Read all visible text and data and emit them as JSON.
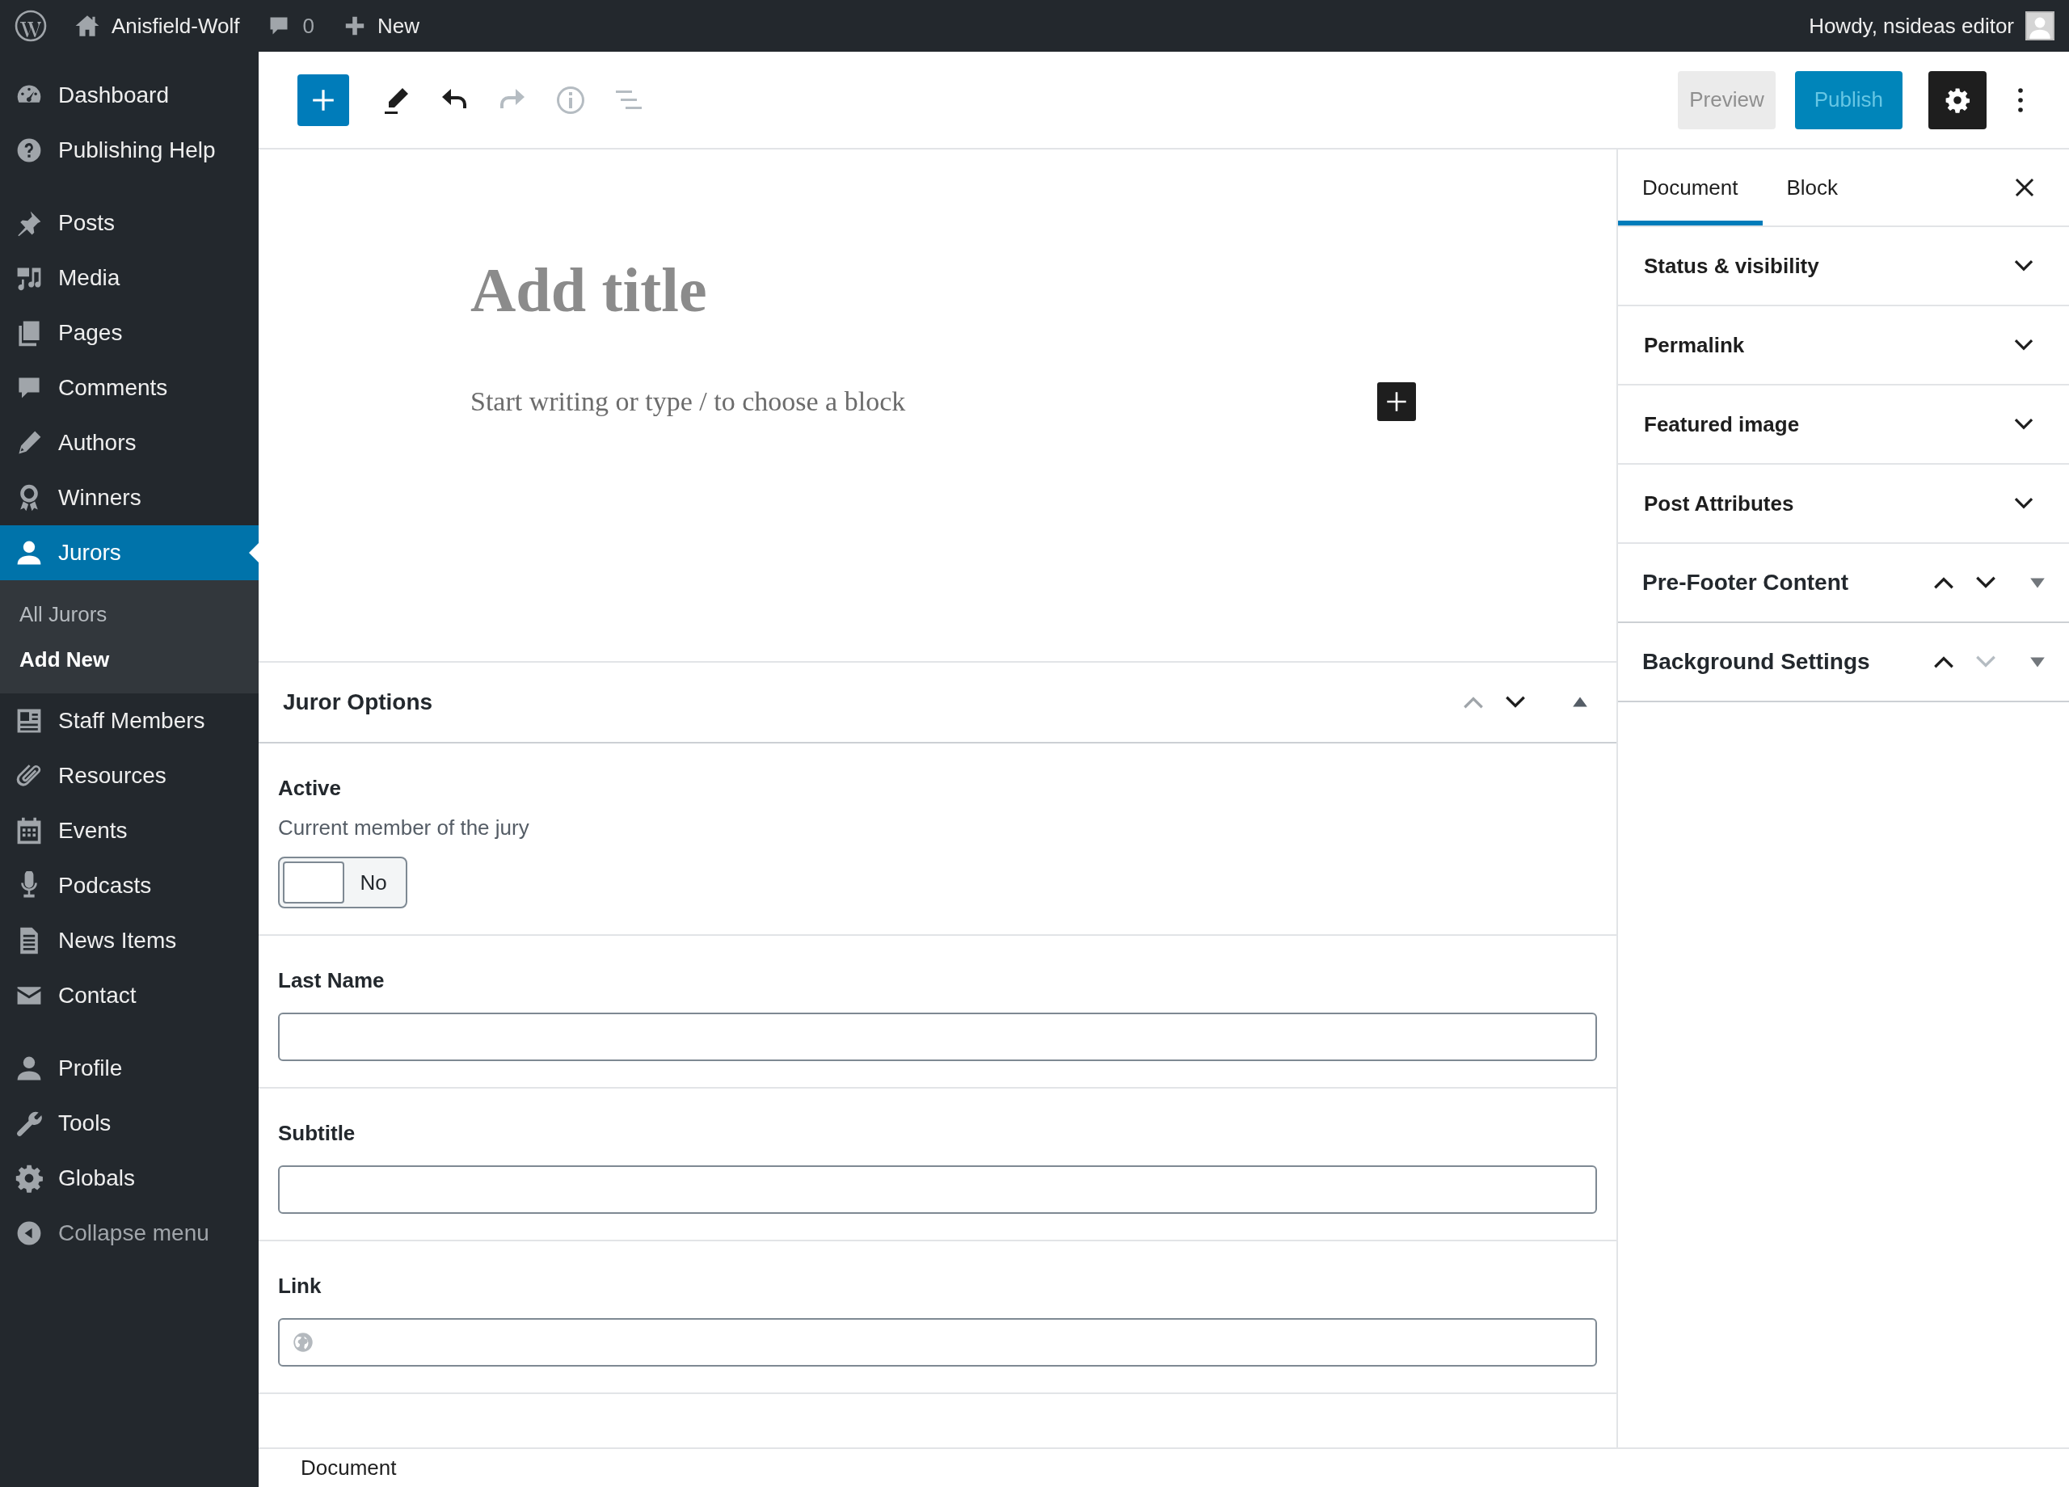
{
  "admin_bar": {
    "site_name": "Anisfield-Wolf",
    "comment_count": "0",
    "new_label": "New",
    "greeting": "Howdy, nsideas editor"
  },
  "admin_menu": {
    "groups": [
      [
        {
          "label": "Dashboard",
          "kind": "item",
          "selected": false
        },
        {
          "label": "Publishing Help",
          "kind": "item",
          "selected": false
        }
      ],
      [
        {
          "label": "Posts",
          "kind": "item",
          "selected": false
        },
        {
          "label": "Media",
          "kind": "item",
          "selected": false
        },
        {
          "label": "Pages",
          "kind": "item",
          "selected": false
        },
        {
          "label": "Comments",
          "kind": "item",
          "selected": false
        },
        {
          "label": "Authors",
          "kind": "item",
          "selected": false
        },
        {
          "label": "Winners",
          "kind": "item",
          "selected": false
        },
        {
          "label": "Jurors",
          "kind": "item",
          "selected": true,
          "children": [
            {
              "label": "All Jurors",
              "selected": false
            },
            {
              "label": "Add New",
              "selected": true
            }
          ]
        },
        {
          "label": "Staff Members",
          "kind": "item",
          "selected": false
        },
        {
          "label": "Resources",
          "kind": "item",
          "selected": false
        },
        {
          "label": "Events",
          "kind": "item",
          "selected": false
        },
        {
          "label": "Podcasts",
          "kind": "item",
          "selected": false
        },
        {
          "label": "News Items",
          "kind": "item",
          "selected": false
        },
        {
          "label": "Contact",
          "kind": "item",
          "selected": false
        }
      ],
      [
        {
          "label": "Profile",
          "kind": "item",
          "selected": false
        },
        {
          "label": "Tools",
          "kind": "item",
          "selected": false
        },
        {
          "label": "Globals",
          "kind": "item",
          "selected": false
        },
        {
          "label": "Collapse menu",
          "kind": "collapse",
          "selected": false
        }
      ]
    ]
  },
  "toolbar": {
    "tools": [
      {
        "disabled": false
      },
      {
        "disabled": false
      },
      {
        "disabled": true
      },
      {
        "disabled": true
      },
      {
        "disabled": true
      }
    ],
    "preview": {
      "label": "Preview",
      "disabled": true
    },
    "publish": {
      "label": "Publish",
      "disabled": true
    },
    "settings_pressed": true
  },
  "editor": {
    "title_placeholder": "Add title",
    "block_placeholder": "Start writing or type / to choose a block"
  },
  "meta_box": {
    "title": "Juror Options",
    "expanded": true,
    "move_up_disabled": true,
    "move_down_disabled": false,
    "fields": [
      {
        "kind": "toggle",
        "label": "Active",
        "description": "Current member of the jury",
        "on": false,
        "state_label": "No"
      },
      {
        "kind": "text",
        "label": "Last Name"
      },
      {
        "kind": "text",
        "label": "Subtitle"
      },
      {
        "kind": "url",
        "label": "Link"
      }
    ]
  },
  "settings_sidebar": {
    "tabs": [
      {
        "label": "Document",
        "selected": true
      },
      {
        "label": "Block",
        "selected": false
      }
    ],
    "panels": [
      {
        "title": "Status & visibility",
        "kind": "core",
        "expanded": false
      },
      {
        "title": "Permalink",
        "kind": "core",
        "expanded": false
      },
      {
        "title": "Featured image",
        "kind": "core",
        "expanded": false
      },
      {
        "title": "Post Attributes",
        "kind": "core",
        "expanded": false
      },
      {
        "title": "Pre-Footer Content",
        "kind": "metabox",
        "expanded": false,
        "move_up_disabled": false,
        "move_down_disabled": false
      },
      {
        "title": "Background Settings",
        "kind": "metabox",
        "expanded": false,
        "move_up_disabled": false,
        "move_down_disabled": true
      }
    ]
  },
  "footer": {
    "breadcrumb": "Document"
  }
}
